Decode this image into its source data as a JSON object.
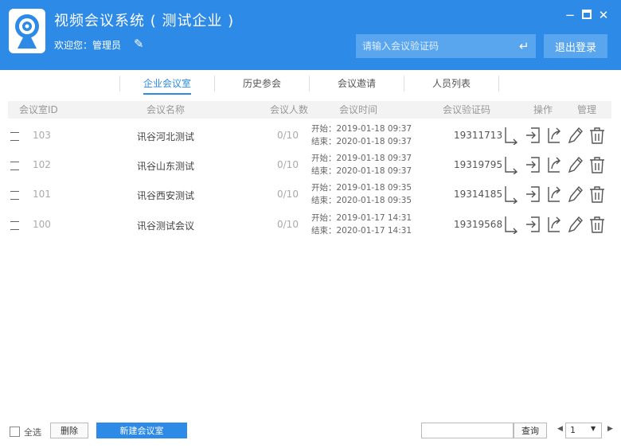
{
  "header": {
    "title": "视频会议系统 ( 测试企业 )",
    "welcome": "欢迎您：管理员",
    "verify_placeholder": "请输入会议验证码",
    "logout_label": "退出登录"
  },
  "tabs": [
    "企业会议室",
    "历史参会",
    "会议邀请",
    "人员列表"
  ],
  "table": {
    "headers": {
      "id": "会议室ID",
      "name": "会议名称",
      "count": "会议人数",
      "time": "会议时间",
      "code": "会议验证码",
      "ops": "操作",
      "manage": "管理"
    },
    "rows": [
      {
        "id": "103",
        "name": "讯谷河北测试",
        "count": "0/10",
        "start": "开始：2019-01-18 09:37",
        "end": "结束：2020-01-18 09:37",
        "code": "19311713"
      },
      {
        "id": "102",
        "name": "讯谷山东测试",
        "count": "0/10",
        "start": "开始：2019-01-18 09:37",
        "end": "结束：2020-01-18 09:37",
        "code": "19319795"
      },
      {
        "id": "101",
        "name": "讯谷西安测试",
        "count": "0/10",
        "start": "开始：2019-01-18 09:35",
        "end": "结束：2020-01-18 09:35",
        "code": "19314185"
      },
      {
        "id": "100",
        "name": "讯谷测试会议",
        "count": "0/10",
        "start": "开始：2019-01-17 14:31",
        "end": "结束：2020-01-17 14:31",
        "code": "19319568"
      }
    ]
  },
  "footer": {
    "select_all": "全选",
    "delete_label": "删除",
    "new_label": "新建会议室",
    "query_label": "查询",
    "page": "1"
  },
  "colors": {
    "primary": "#2d8ae6",
    "input_bg": "#5aa6ee"
  }
}
